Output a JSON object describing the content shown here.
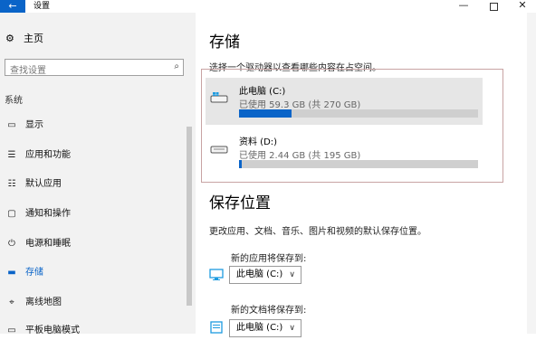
{
  "window": {
    "title": "设置",
    "back_icon": "←",
    "min_icon": "—",
    "close_icon": "✕"
  },
  "sidebar": {
    "home": {
      "icon": "⚙",
      "label": "主页"
    },
    "search": {
      "placeholder": "查找设置",
      "icon": "⌕"
    },
    "section": "系统",
    "items": [
      {
        "icon": "▭",
        "label": "显示",
        "active": false
      },
      {
        "icon": "☰",
        "label": "应用和功能",
        "active": false
      },
      {
        "icon": "☷",
        "label": "默认应用",
        "active": false
      },
      {
        "icon": "▢",
        "label": "通知和操作",
        "active": false
      },
      {
        "icon": "⏻",
        "label": "电源和睡眠",
        "active": false
      },
      {
        "icon": "▬",
        "label": "存储",
        "active": true
      },
      {
        "icon": "⌖",
        "label": "离线地图",
        "active": false
      },
      {
        "icon": "▭",
        "label": "平板电脑模式",
        "active": false
      }
    ]
  },
  "main": {
    "title": "存储",
    "description": "选择一个驱动器以查看哪些内容在占空间。",
    "drives": [
      {
        "name": "此电脑 (C:)",
        "usage": "已使用 59.3 GB (共 270 GB)",
        "used_fraction": 0.22,
        "selected": true
      },
      {
        "name": "资料 (D:)",
        "usage": "已使用 2.44 GB (共 195 GB)",
        "used_fraction": 0.013,
        "selected": false
      }
    ],
    "save_section": {
      "title": "保存位置",
      "description": "更改应用、文档、音乐、图片和视频的默认保存位置。",
      "items": [
        {
          "label": "新的应用将保存到:",
          "value": "此电脑 (C:)"
        },
        {
          "label": "新的文档将保存到:",
          "value": "此电脑 (C:)"
        }
      ]
    }
  },
  "colors": {
    "accent": "#0a64c8",
    "bar_bg": "#cfcfcf"
  }
}
